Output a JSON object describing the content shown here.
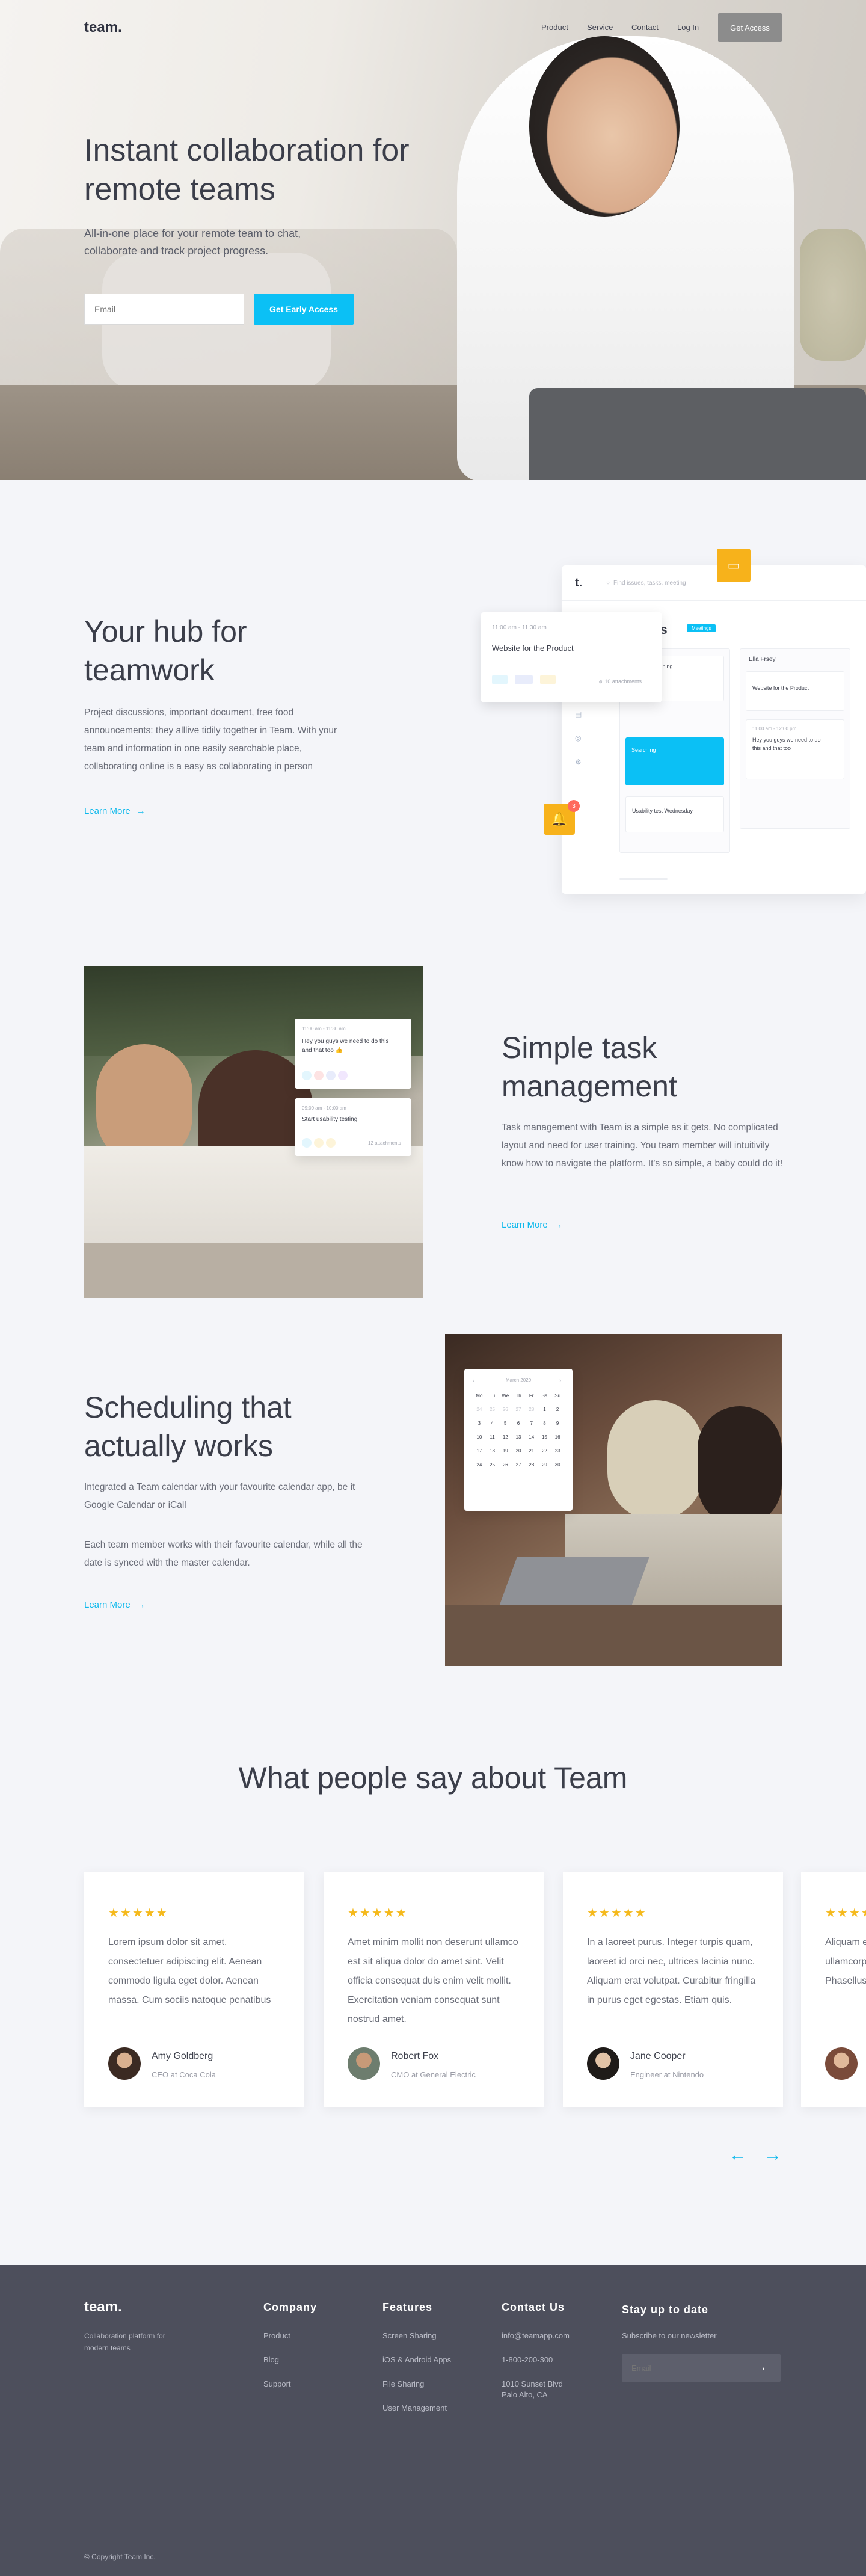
{
  "nav": {
    "logo": "team.",
    "links": [
      "Product",
      "Service",
      "Contact",
      "Log In"
    ],
    "cta": "Get Access"
  },
  "hero": {
    "title": "Instant collaboration for remote teams",
    "subtitle": "All-in-one place for your remote team to chat, collaborate and track project progress.",
    "email_placeholder": "Email",
    "cta": "Get Early Access"
  },
  "hub": {
    "title": "Your hub for teamwork",
    "text": "Project discussions, important document, free food announcements: they alllive tidily together in Team. With your team and information in one easily searchable place, collaborating online is a easy as collaborating in person",
    "link": "Learn More",
    "mock": {
      "logo": "t.",
      "search": "Find issues, tasks, meeting",
      "board_title": "gs",
      "badge": "Meetings",
      "popup_time": "11:00 am - 11:30 am",
      "popup_title": "Website for the Product",
      "popup_attachments": "10 attachments",
      "col2_title": "Ella Frsey",
      "card_a": "Product planning",
      "card_b": "Website for the Product",
      "card_c_time": "11:00 am - 12:00 pm",
      "card_c": "Hey you guys we need to do this and that too",
      "card_d": "Searching",
      "card_e": "Usability test Wednesday",
      "bell_count": "3"
    }
  },
  "tasks": {
    "title": "Simple task management",
    "text": "Task management with Team is a simple as it gets. No complicated layout and need for user training. You team member will intuitivily know how to navigate the platform. It's so simple, a baby could do it!",
    "link": "Learn More",
    "overlay": {
      "time1": "11:00 am - 11:30 am",
      "msg1": "Hey you guys we need to do this and that too 👍",
      "time2": "09:00 am - 10:00 am",
      "msg2": "Start usability testing",
      "attach2": "12 attachments"
    }
  },
  "schedule": {
    "title": "Scheduling that actually works",
    "text1": "Integrated a Team calendar with your favourite calendar app, be it Google Calendar or iCall",
    "text2": "Each team member works with their favourite calendar, while all the date is synced with the master calendar.",
    "link": "Learn More",
    "calendar": {
      "month": "March 2020",
      "days": [
        "Mo",
        "Tu",
        "We",
        "Th",
        "Fr",
        "Sa",
        "Su"
      ],
      "rows": [
        [
          "24",
          "25",
          "26",
          "27",
          "28",
          "1",
          "2"
        ],
        [
          "3",
          "4",
          "5",
          "6",
          "7",
          "8",
          "9"
        ],
        [
          "10",
          "11",
          "12",
          "13",
          "14",
          "15",
          "16"
        ],
        [
          "17",
          "18",
          "19",
          "20",
          "21",
          "22",
          "23"
        ],
        [
          "24",
          "25",
          "26",
          "27",
          "28",
          "29",
          "30"
        ]
      ]
    }
  },
  "testimonials": {
    "title": "What people say about Team",
    "stars": "★★★★★",
    "items": [
      {
        "text": "Lorem ipsum dolor sit amet, consectetuer adipiscing elit. Aenean commodo ligula eget dolor. Aenean massa. Cum sociis natoque penatibus",
        "name": "Amy Goldberg",
        "role": "CEO at Coca Cola"
      },
      {
        "text": "Amet minim mollit non deserunt ullamco est sit aliqua dolor do amet sint. Velit officia consequat duis enim velit mollit. Exercitation veniam consequat sunt nostrud amet.",
        "name": "Robert Fox",
        "role": "CMO at General Electric"
      },
      {
        "text": "In a laoreet purus. Integer turpis quam, laoreet id orci nec, ultrices lacinia nunc. Aliquam erat volutpat. Curabitur fringilla in purus eget egestas. Etiam quis.",
        "name": "Jane Cooper",
        "role": "Engineer at Nintendo"
      },
      {
        "text": "Aliquam erat volutpat. Donec sed ullamcorper luctus sem vel vulputate. Phasellus",
        "name": "",
        "role": ""
      }
    ]
  },
  "footer": {
    "logo": "team.",
    "tagline": "Collaboration platform for modern teams",
    "company_h": "Company",
    "company": [
      "Product",
      "Blog",
      "Support"
    ],
    "features_h": "Features",
    "features": [
      "Screen Sharing",
      "iOS & Android Apps",
      "File Sharing",
      "User Management"
    ],
    "contact_h": "Contact Us",
    "contact": [
      "info@teamapp.com",
      "1-800-200-300",
      "1010 Sunset Blvd",
      "Palo Alto, CA"
    ],
    "stay_h": "Stay up to date",
    "stay_sub": "Subscribe to our newsletter",
    "email_placeholder": "Email",
    "copyright": "© Copyright Team Inc."
  },
  "colors": {
    "accent": "#0bc0f5",
    "star": "#f5b91b",
    "footer": "#4d4f5c",
    "bell": "#f7b21b"
  }
}
